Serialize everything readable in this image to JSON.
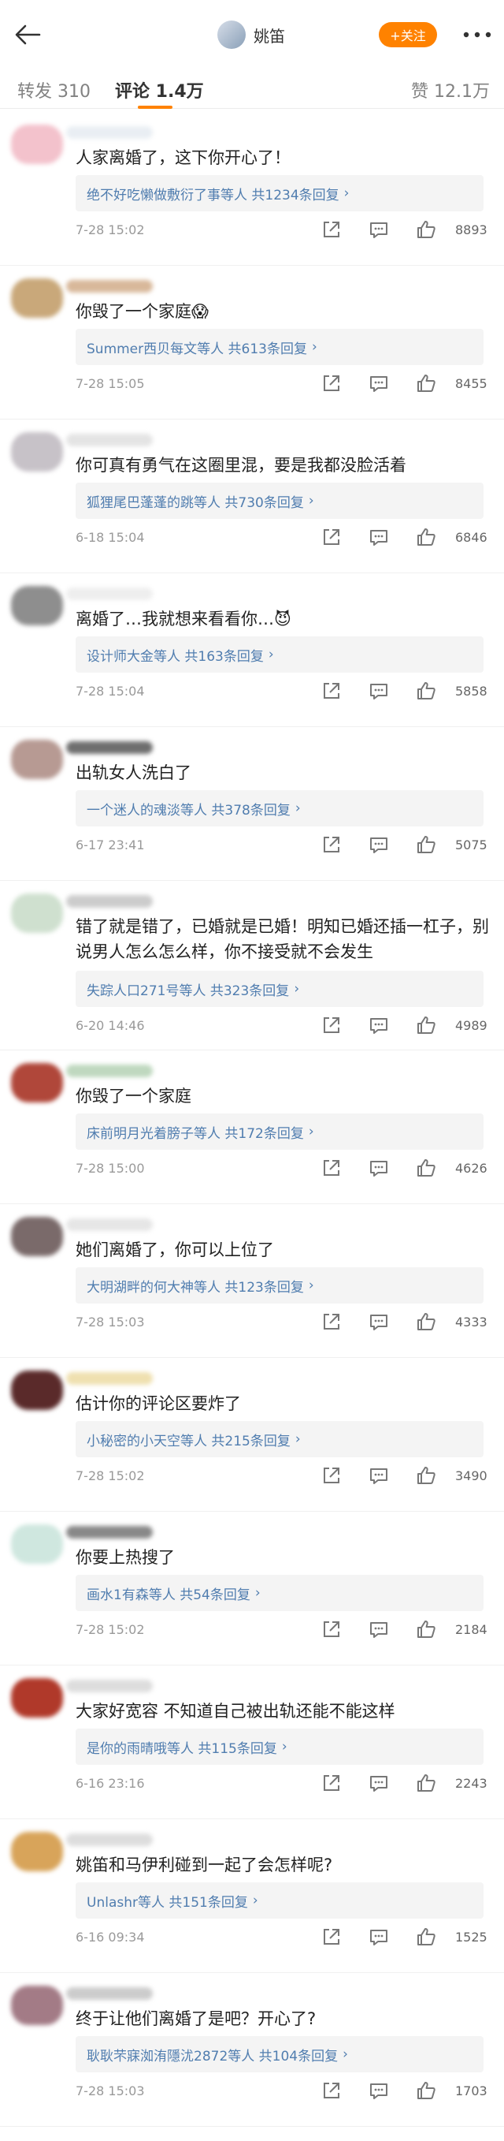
{
  "header": {
    "username": "姚笛",
    "follow_label": "+关注"
  },
  "tabs": {
    "repost": "转发 310",
    "comments": "评论 1.4万",
    "likes": "赞 12.1万"
  },
  "colors": {
    "accent": "#ff8200",
    "link": "#507daf"
  },
  "comments": [
    {
      "text": "人家离婚了，这下你开心了！",
      "reply_summary": "绝不好吃懒做敷衍了事等人 共1234条回复",
      "time": "7-28 15:02",
      "likes": "8893",
      "avatar_color": "#f3c2cc",
      "name_color": "#e9eef3"
    },
    {
      "text": "你毁了一个家庭😱",
      "reply_summary": "Summer西贝每文等人 共613条回复",
      "time": "7-28 15:05",
      "likes": "8455",
      "avatar_color": "#c9a87a",
      "name_color": "#d8b89a"
    },
    {
      "text": "你可真有勇气在这圈里混，要是我都没脸活着",
      "reply_summary": "狐狸尾巴蓬蓬的跳等人 共730条回复",
      "time": "6-18 15:04",
      "likes": "6846",
      "avatar_color": "#c7c2c8",
      "name_color": "#e4e4e4"
    },
    {
      "text": "离婚了…我就想来看看你…😈",
      "reply_summary": "设计师大金等人 共163条回复",
      "time": "7-28 15:04",
      "likes": "5858",
      "avatar_color": "#8e8e8e",
      "name_color": "#eeeeee"
    },
    {
      "text": "出轨女人洗白了",
      "reply_summary": "一个迷人的魂淡等人 共378条回复",
      "time": "6-17 23:41",
      "likes": "5075",
      "avatar_color": "#b79a93",
      "name_color": "#6e6e6e"
    },
    {
      "text": "错了就是错了，已婚就是已婚！明知已婚还插一杠子，别说男人怎么怎么样，你不接受就不会发生",
      "reply_summary": "失踪人口271号等人 共323条回复",
      "time": "6-20 14:46",
      "likes": "4989",
      "avatar_color": "#cfe0cf",
      "name_color": "#cccccc"
    },
    {
      "text": "你毁了一个家庭",
      "reply_summary": "床前明月光着膀子等人 共172条回复",
      "time": "7-28 15:00",
      "likes": "4626",
      "avatar_color": "#b0473a",
      "name_color": "#bfd8bf"
    },
    {
      "text": "她们离婚了，你可以上位了",
      "reply_summary": "大明湖畔的何大神等人 共123条回复",
      "time": "7-28 15:03",
      "likes": "4333",
      "avatar_color": "#7a6a6a",
      "name_color": "#e6e6e6"
    },
    {
      "text": "估计你的评论区要炸了",
      "reply_summary": "小秘密的小天空等人 共215条回复",
      "time": "7-28 15:02",
      "likes": "3490",
      "avatar_color": "#5a2a2a",
      "name_color": "#efe0b0"
    },
    {
      "text": "你要上热搜了",
      "reply_summary": "画水1有森等人 共54条回复",
      "time": "7-28 15:02",
      "likes": "2184",
      "avatar_color": "#cfe7df",
      "name_color": "#888888"
    },
    {
      "text": "大家好宽容 不知道自己被出轨还能不能这样",
      "reply_summary": "是你的雨晴哦等人 共115条回复",
      "time": "6-16 23:16",
      "likes": "2243",
      "avatar_color": "#b0392a",
      "name_color": "#dddddd"
    },
    {
      "text": "姚笛和马伊利碰到一起了会怎样呢?",
      "reply_summary": "Unlashr等人 共151条回复",
      "time": "6-16 09:34",
      "likes": "1525",
      "avatar_color": "#d8a45a",
      "name_color": "#dddddd"
    },
    {
      "text": "终于让他们离婚了是吧？开心了?",
      "reply_summary": "耿耿芣寐洳洧隱沋2872等人 共104条回复",
      "time": "7-28 15:03",
      "likes": "1703",
      "avatar_color": "#a37b86",
      "name_color": "#cccccc"
    }
  ]
}
